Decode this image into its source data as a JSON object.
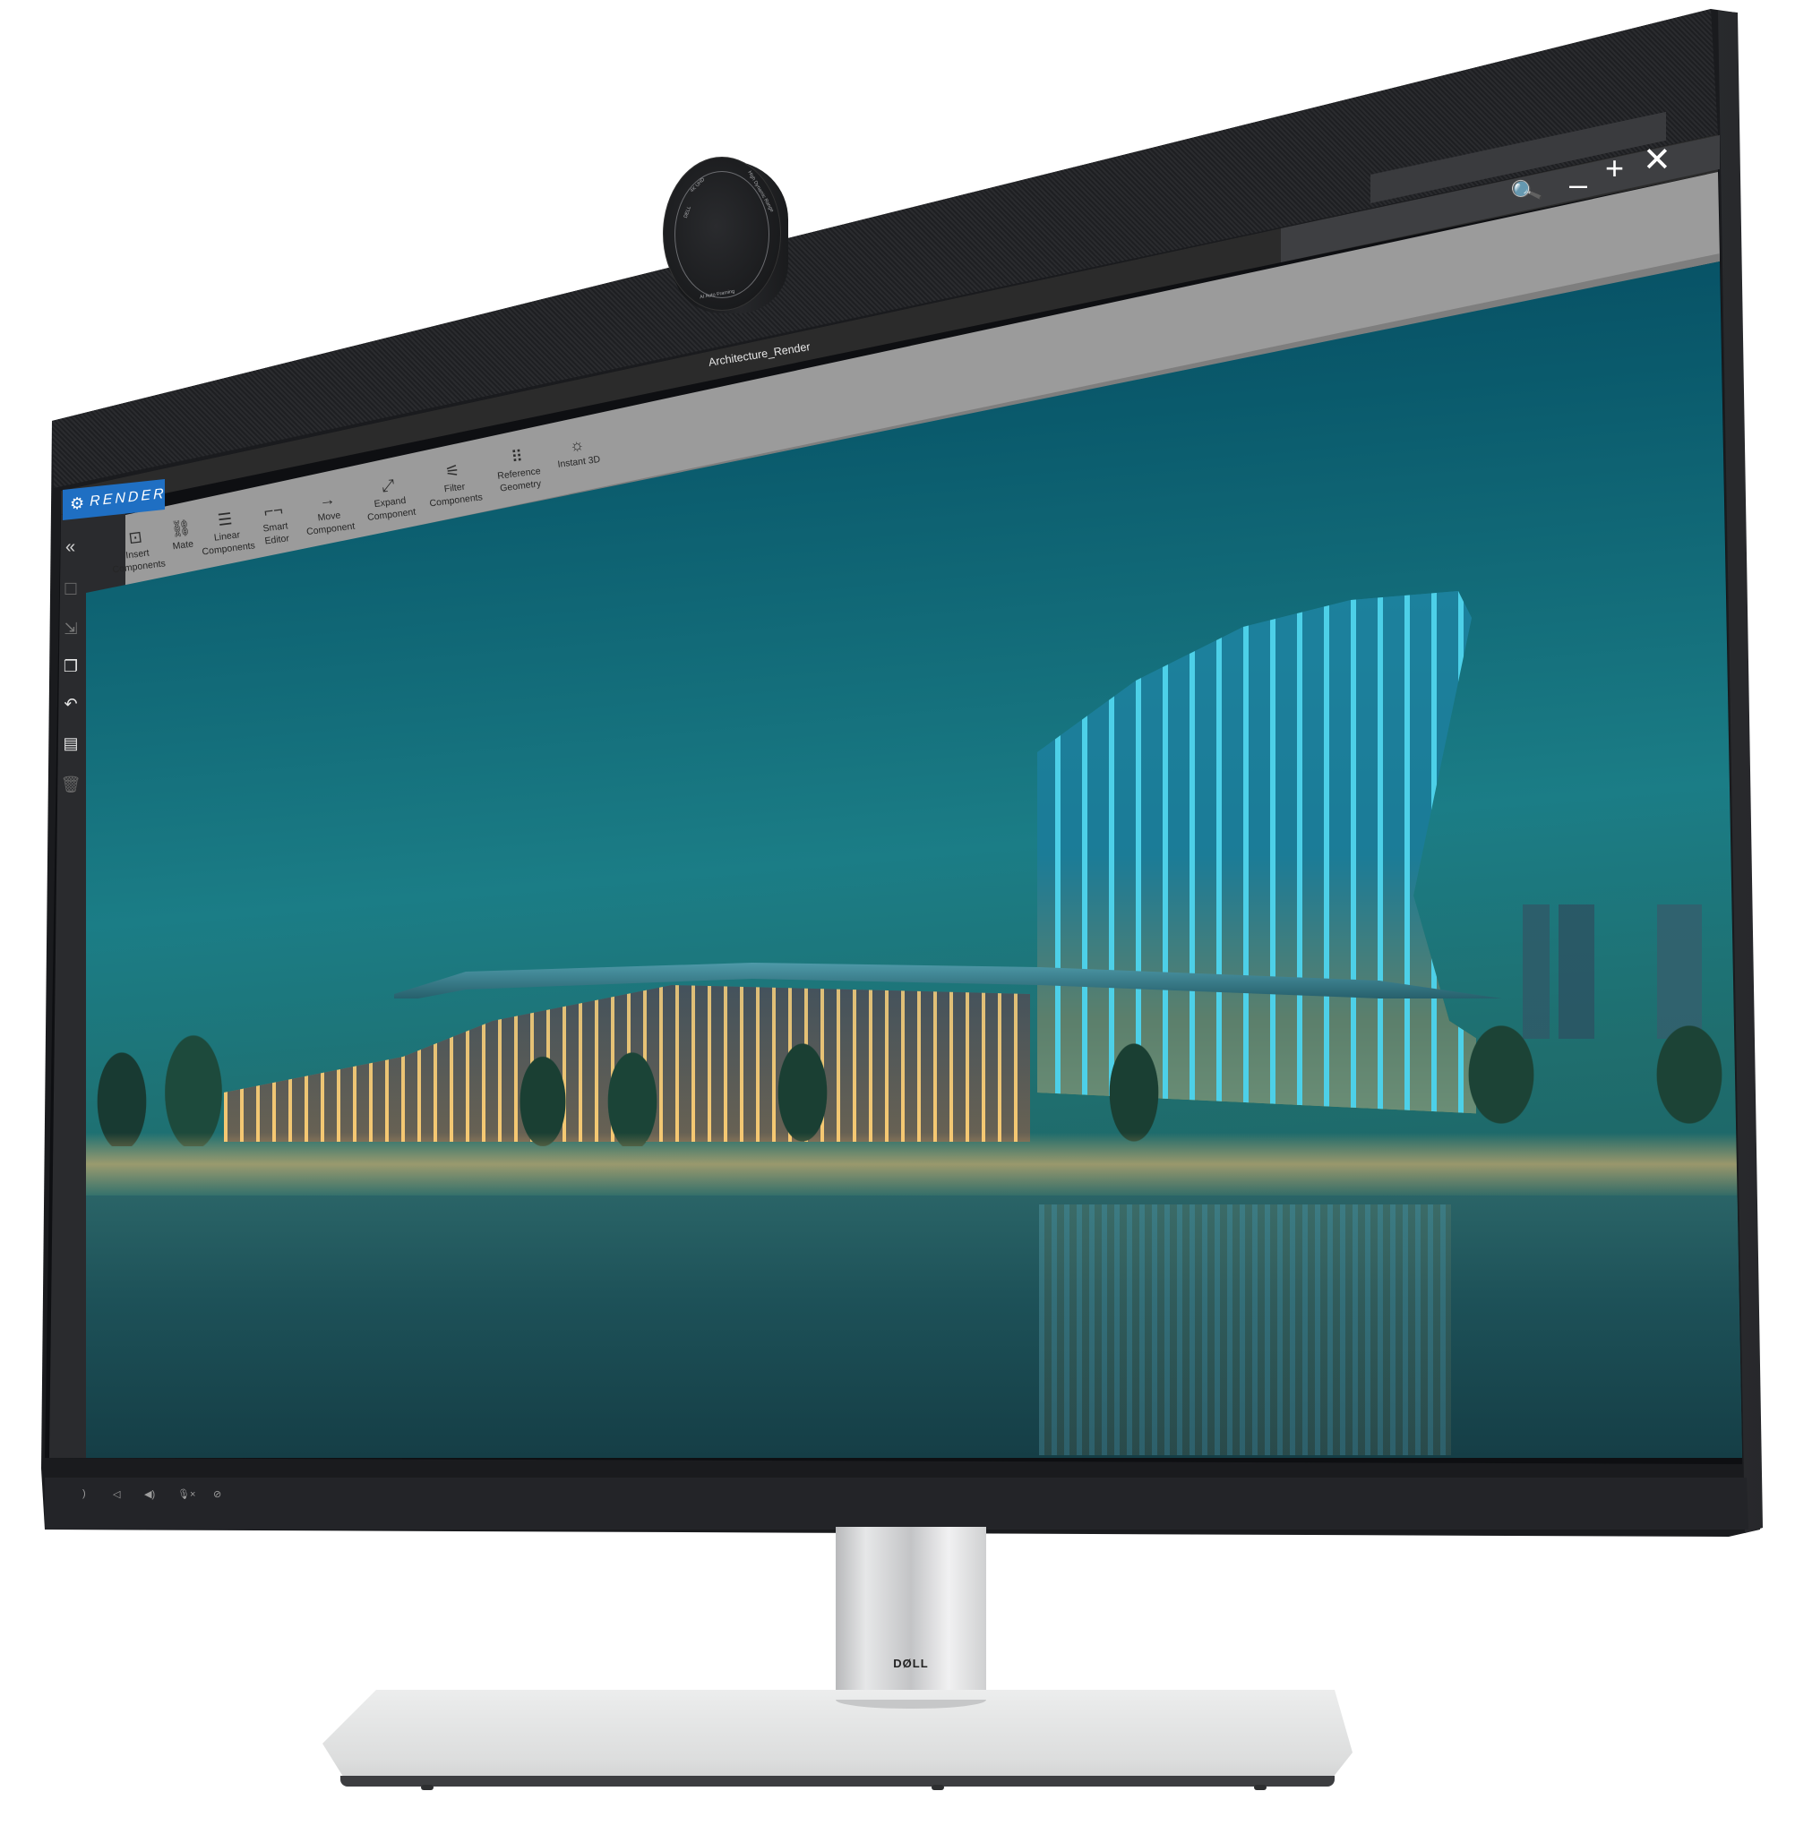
{
  "window": {
    "document_title": "Architecture_Render",
    "search_placeholder": "",
    "controls": {
      "search_icon": "🔍",
      "minimize": "–",
      "maximize": "+",
      "close": "✕"
    }
  },
  "app": {
    "name": "RENDER",
    "logo_icon": "⚙",
    "accent_color": "#1f6fc3"
  },
  "ribbon": {
    "tools": [
      {
        "icon": "⊡",
        "icon_name": "insert-icon",
        "line1": "Insert",
        "line2": "Components"
      },
      {
        "icon": "⛓",
        "icon_name": "link-icon",
        "line1": "Mate",
        "line2": ""
      },
      {
        "icon": "☰",
        "icon_name": "menu-lines-icon",
        "line1": "Linear",
        "line2": "Components"
      },
      {
        "icon": "⌐¬",
        "icon_name": "focus-corners-icon",
        "line1": "Smart",
        "line2": "Editor"
      },
      {
        "icon": "→",
        "icon_name": "arrow-right-icon",
        "line1": "Move",
        "line2": "Component"
      },
      {
        "icon": "⤢",
        "icon_name": "expand-icon",
        "line1": "Expand",
        "line2": "Component"
      },
      {
        "icon": "⚟",
        "icon_name": "sliders-icon",
        "line1": "Filter",
        "line2": "Components"
      },
      {
        "icon": "⠿",
        "icon_name": "grid-icon",
        "line1": "Reference",
        "line2": "Geometry"
      },
      {
        "icon": "☼",
        "icon_name": "sun-icon",
        "line1": "Instant 3D",
        "line2": ""
      }
    ]
  },
  "sidebar": {
    "collapse_icon": "«",
    "items": [
      {
        "icon": "☐",
        "name": "square-icon",
        "disabled": true
      },
      {
        "icon": "⇲",
        "name": "export-icon",
        "disabled": true
      },
      {
        "icon": "❐",
        "name": "windows-icon",
        "disabled": false
      },
      {
        "icon": "↶",
        "name": "undo-icon",
        "disabled": false
      },
      {
        "icon": "▤",
        "name": "document-icon",
        "disabled": false
      },
      {
        "icon": "🗑",
        "name": "trash-icon",
        "disabled": true
      }
    ]
  },
  "viewport": {
    "scene": "Night architectural render of a curved glass building by a waterfront"
  },
  "webcam": {
    "brand": "DELL",
    "label_top": "4K UHD",
    "label_right": "High Dynamic Range",
    "label_bottom": "AI Auto Framing"
  },
  "bezel_controls": [
    {
      "icon": ")",
      "name": "power-icon"
    },
    {
      "icon": "◁",
      "name": "volume-down-icon"
    },
    {
      "icon": "◀)",
      "name": "volume-up-icon"
    },
    {
      "icon": "🎙×",
      "name": "mic-mute-icon"
    },
    {
      "icon": "⊘",
      "name": "camera-off-icon"
    }
  ],
  "stand": {
    "logo": "DØLL"
  }
}
